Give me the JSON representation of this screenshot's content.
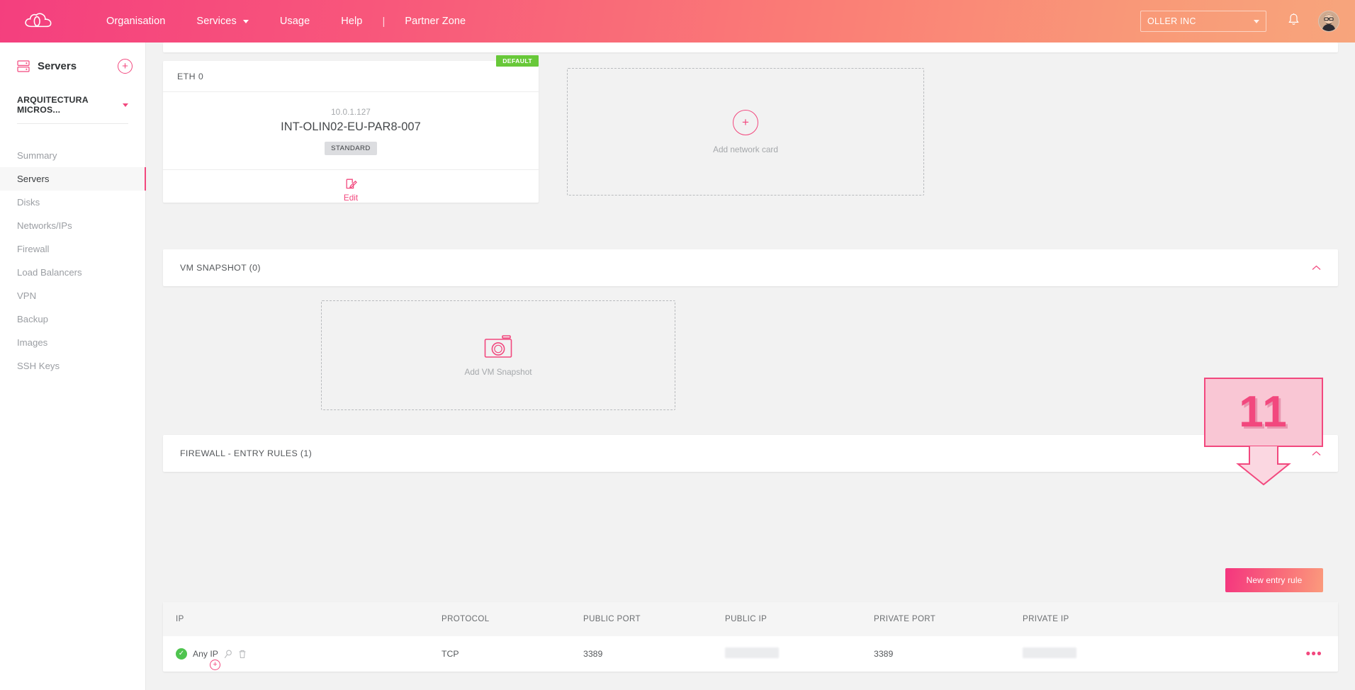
{
  "header": {
    "logo_icon": "cloud-logo-icon",
    "nav": [
      {
        "label": "Organisation",
        "caret": false
      },
      {
        "label": "Services",
        "caret": true
      },
      {
        "label": "Usage",
        "caret": false
      },
      {
        "label": "Help",
        "caret": false
      },
      {
        "label": "Partner Zone",
        "caret": false
      }
    ],
    "separator": "|",
    "org_selector": {
      "value": "OLLER INC"
    },
    "bell_icon": "notification-bell-icon",
    "avatar_icon": "user-avatar"
  },
  "sidebar": {
    "section_title": "Servers",
    "section_icon": "servers-rack-icon",
    "add_button": "+",
    "project": "ARQUITECTURA MICROS...",
    "items": [
      {
        "label": "Summary",
        "active": false
      },
      {
        "label": "Servers",
        "active": true
      },
      {
        "label": "Disks",
        "active": false
      },
      {
        "label": "Networks/IPs",
        "active": false
      },
      {
        "label": "Firewall",
        "active": false
      },
      {
        "label": "Load Balancers",
        "active": false
      },
      {
        "label": "VPN",
        "active": false
      },
      {
        "label": "Backup",
        "active": false
      },
      {
        "label": "Images",
        "active": false
      },
      {
        "label": "SSH Keys",
        "active": false
      }
    ]
  },
  "network": {
    "eth_label": "ETH 0",
    "badge": "DEFAULT",
    "ip": "10.0.1.127",
    "name": "INT-OLIN02-EU-PAR8-007",
    "chip": "STANDARD",
    "edit_label": "Edit",
    "edit_icon": "edit-pencil-icon",
    "add_card_label": "Add network card",
    "add_card_icon": "plus-circle-icon"
  },
  "snapshot": {
    "panel_title": "VM SNAPSHOT (0)",
    "collapse_icon": "chevron-up-icon",
    "add_label": "Add VM Snapshot",
    "add_icon": "camera-icon"
  },
  "firewall": {
    "panel_title": "FIREWALL - ENTRY RULES (1)",
    "collapse_icon": "chevron-up-icon",
    "new_rule_button": "New entry rule",
    "columns": [
      "IP",
      "PROTOCOL",
      "PUBLIC PORT",
      "PUBLIC IP",
      "PRIVATE PORT",
      "PRIVATE IP"
    ],
    "rows": [
      {
        "status_icon": "check-circle-icon",
        "ip": "Any IP",
        "search_icon": "magnifier-icon",
        "delete_icon": "trash-icon",
        "add_icon": "plus-circle-small-icon",
        "protocol": "TCP",
        "public_port": "3389",
        "public_ip": "",
        "private_port": "3389",
        "private_ip": "",
        "menu_icon": "ellipsis-icon"
      }
    ]
  },
  "annotation": {
    "step_number": "11",
    "arrow_icon": "down-arrow-icon"
  },
  "colors": {
    "accent": "#f2487e",
    "gradient_start": "#f43f7e",
    "gradient_end": "#f7a57c",
    "badge_green": "#68c839",
    "status_green": "#4fc44f"
  }
}
